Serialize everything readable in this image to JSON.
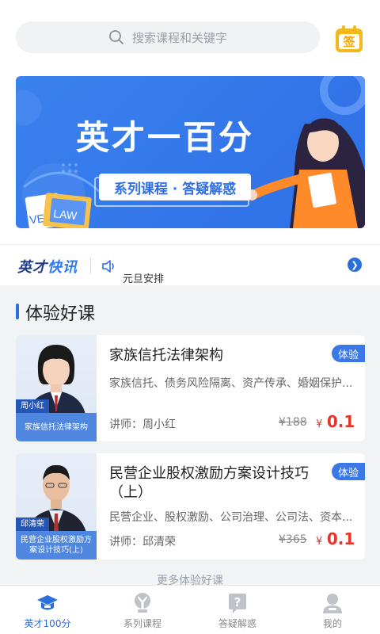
{
  "search": {
    "placeholder": "搜索课程和关键字"
  },
  "sign": {
    "label": "签"
  },
  "banner": {
    "title": "英才一百分",
    "subtitle": "系列课程 · 答疑解惑",
    "book_labels": [
      "VE",
      "LAW"
    ]
  },
  "news": {
    "logo_a": "英才",
    "logo_b": "快讯",
    "text": "元旦安排"
  },
  "section": {
    "title": "体验好课"
  },
  "courses": [
    {
      "title": "家族信托法律架构",
      "tag": "体验",
      "keywords": "家族信托、债务风险隔离、资产传承、婚姻保护...",
      "teacher": "讲师：周小红",
      "old_price": "¥188",
      "price_symbol": "¥",
      "price": "0.1",
      "thumb_name": "周小红",
      "thumb_caption": "家族信托法律架构"
    },
    {
      "title": "民营企业股权激励方案设计技巧（上）",
      "tag": "体验",
      "keywords": "民营企业、股权激励、公司治理、公司法、资本...",
      "teacher": "讲师：邱清荣",
      "old_price": "¥365",
      "price_symbol": "¥",
      "price": "0.1",
      "thumb_name": "邱清荣",
      "thumb_caption": "民营企业股权激励方案设计技巧(上)"
    }
  ],
  "more": {
    "label": "更多体验好课"
  },
  "tabs": [
    {
      "label": "英才100分",
      "icon": "graduation-cap-icon",
      "active": true
    },
    {
      "label": "系列课程",
      "icon": "trophy-icon",
      "active": false
    },
    {
      "label": "答疑解惑",
      "icon": "question-icon",
      "active": false
    },
    {
      "label": "我的",
      "icon": "user-icon",
      "active": false
    }
  ],
  "colors": {
    "accent": "#2a6fdb",
    "price": "#e8352c",
    "banner": "#3a82ee",
    "sign_badge": "#f5b81c"
  }
}
